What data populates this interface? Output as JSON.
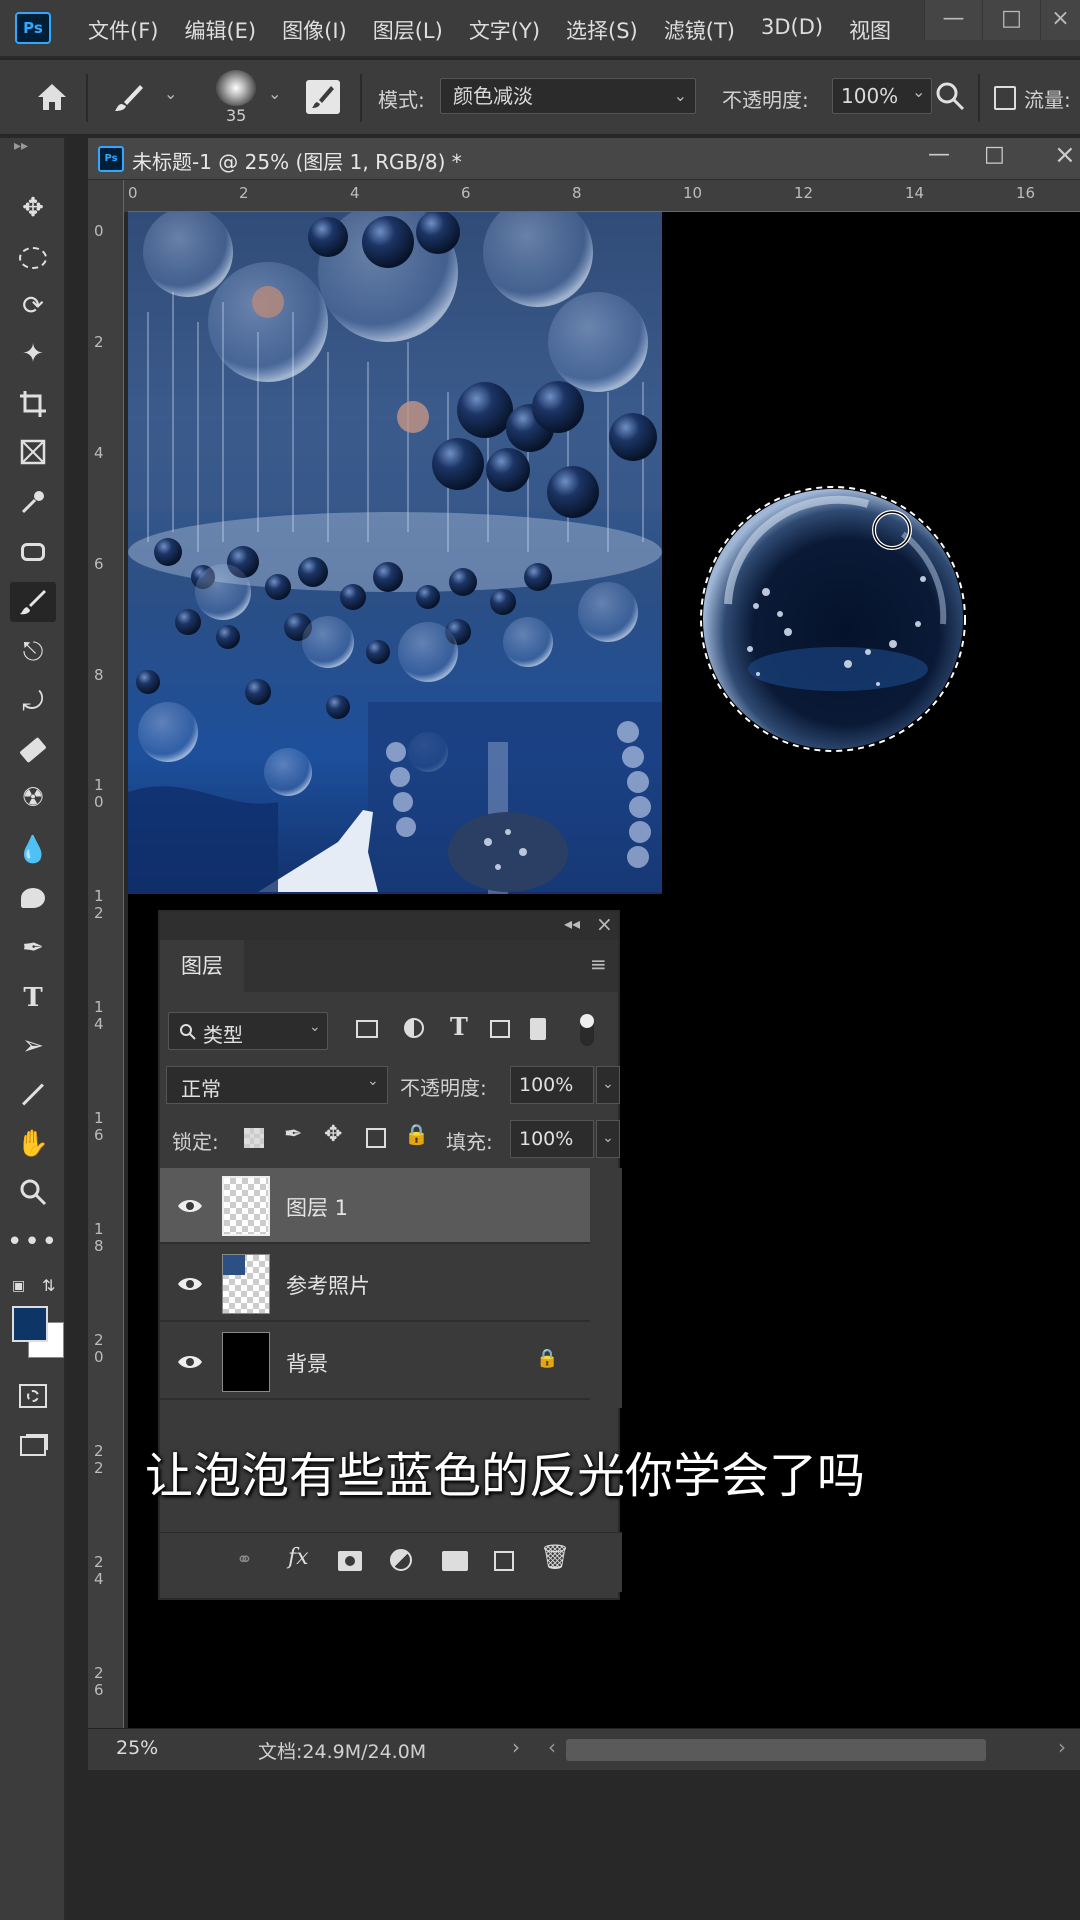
{
  "app": {
    "logo": "Ps",
    "menu": [
      "文件(F)",
      "编辑(E)",
      "图像(I)",
      "图层(L)",
      "文字(Y)",
      "选择(S)",
      "滤镜(T)",
      "3D(D)",
      "视图"
    ]
  },
  "options_bar": {
    "brush_size": "35",
    "mode_label": "模式:",
    "mode_value": "颜色减淡",
    "opacity_label": "不透明度:",
    "opacity_value": "100%",
    "flow_label": "流量:"
  },
  "document": {
    "tab_title": "未标题-1 @ 25% (图层 1, RGB/8) *",
    "ruler_h": [
      "0",
      "2",
      "4",
      "6",
      "8",
      "10",
      "12",
      "14",
      "16"
    ],
    "ruler_v": [
      "0",
      "2",
      "4",
      "6",
      "8",
      "10",
      "12",
      "14",
      "16",
      "18",
      "20",
      "22",
      "24",
      "26"
    ],
    "zoom": "25%",
    "doc_size": "文档:24.9M/24.0M"
  },
  "layers_panel": {
    "tab": "图层",
    "filter_label": "类型",
    "blend_mode": "正常",
    "opacity_label": "不透明度:",
    "opacity_value": "100%",
    "lock_label": "锁定:",
    "fill_label": "填充:",
    "fill_value": "100%",
    "layers": [
      {
        "name": "图层 1",
        "selected": true
      },
      {
        "name": "参考照片",
        "selected": false
      },
      {
        "name": "背景",
        "selected": false,
        "locked": true
      }
    ],
    "footer_icons": [
      "link-icon",
      "fx-icon",
      "mask-icon",
      "adjustment-icon",
      "folder-icon",
      "new-layer-icon",
      "trash-icon"
    ]
  },
  "colors": {
    "foreground": "#0d3566",
    "background": "#ffffff",
    "accent": "#31a8ff"
  },
  "subtitle": "让泡泡有些蓝色的反光你学会了吗"
}
